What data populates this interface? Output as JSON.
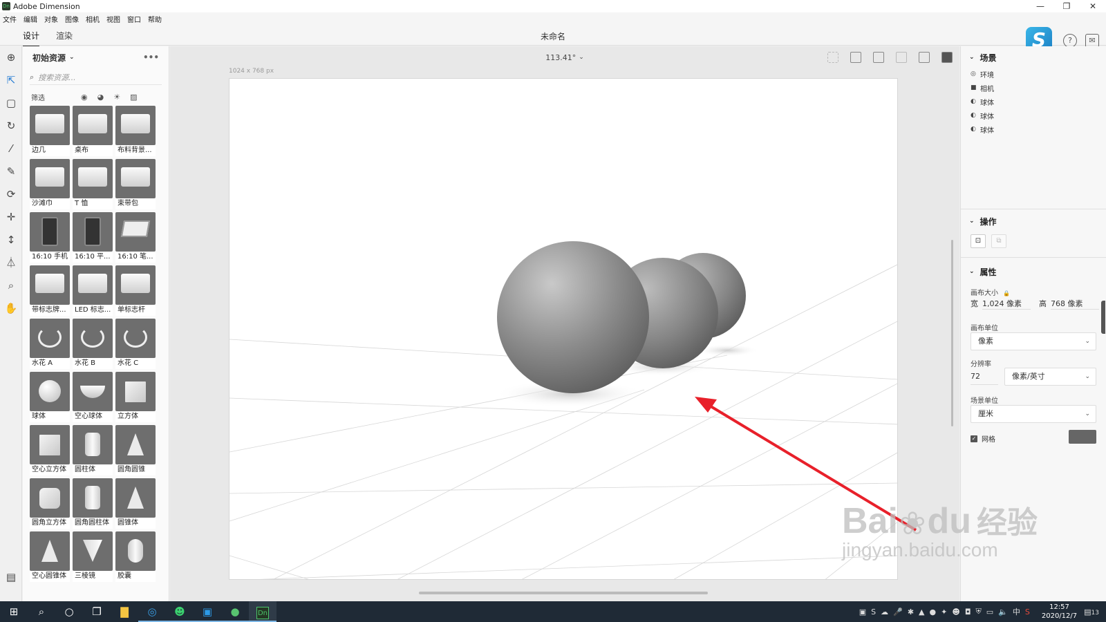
{
  "app": {
    "title": "Adobe Dimension",
    "logo": "Dn"
  },
  "window_controls": {
    "minimize": "—",
    "restore": "❐",
    "close": "✕"
  },
  "menu": [
    "文件",
    "编辑",
    "对象",
    "图像",
    "相机",
    "视图",
    "窗口",
    "帮助"
  ],
  "tabs": {
    "design": "设计",
    "render": "渲染"
  },
  "document": {
    "title": "未命名"
  },
  "top_right": {
    "avatar_letter": "S",
    "help_glyph": "?",
    "chat_glyph": "✉"
  },
  "left_panel": {
    "title": "初始资源",
    "search_placeholder": "搜索资源...",
    "filter_label": "筛选",
    "assets": [
      {
        "label": "边几"
      },
      {
        "label": "桌布"
      },
      {
        "label": "布料背景..."
      },
      {
        "label": "沙滩巾"
      },
      {
        "label": "T 恤"
      },
      {
        "label": "束带包"
      },
      {
        "label": "16:10 手机"
      },
      {
        "label": "16:10 平..."
      },
      {
        "label": "16:10 笔..."
      },
      {
        "label": "带标志牌..."
      },
      {
        "label": "LED 标志..."
      },
      {
        "label": "单标志杆"
      },
      {
        "label": "水花 A"
      },
      {
        "label": "水花 B"
      },
      {
        "label": "水花 C"
      },
      {
        "label": "球体"
      },
      {
        "label": "空心球体"
      },
      {
        "label": "立方体"
      },
      {
        "label": "空心立方体"
      },
      {
        "label": "圆柱体"
      },
      {
        "label": "圆角圆锥"
      },
      {
        "label": "圆角立方体"
      },
      {
        "label": "圆角圆柱体"
      },
      {
        "label": "圆锥体"
      },
      {
        "label": "空心圆锥体"
      },
      {
        "label": "三棱镜"
      },
      {
        "label": "胶囊"
      }
    ]
  },
  "viewport": {
    "zoom": "113.41°",
    "canvas_size": "1024 x 768 px"
  },
  "right_panel": {
    "scene_title": "场景",
    "scene_items": [
      {
        "label": "环境",
        "icon": "environment-icon"
      },
      {
        "label": "相机",
        "icon": "camera-icon"
      },
      {
        "label": "球体",
        "icon": "sphere-icon"
      },
      {
        "label": "球体",
        "icon": "sphere-icon"
      },
      {
        "label": "球体",
        "icon": "sphere-icon"
      }
    ],
    "actions_title": "操作",
    "properties_title": "属性",
    "canvas_size_label": "画布大小",
    "width_label": "宽",
    "width_value": "1,024 像素",
    "height_label": "高",
    "height_value": "768 像素",
    "canvas_unit_label": "画布单位",
    "canvas_unit_value": "像素",
    "resolution_label": "分辨率",
    "resolution_value": "72",
    "resolution_unit": "像素/英寸",
    "scene_unit_label": "场景单位",
    "scene_unit_value": "厘米",
    "grid_label": "网格",
    "grid_checked": true,
    "grid_color": "#666666"
  },
  "taskbar": {
    "time": "12:57",
    "date": "2020/12/7",
    "ime": "中",
    "notification_count": "13",
    "dn_label": "Dn"
  },
  "watermark": {
    "line1": "Bai",
    "line2": "du",
    "cn": "经验",
    "url": "jingyan.baidu.com"
  },
  "colors": {
    "accent_arrow": "#e8202a",
    "taskbar": "#1f2a36",
    "sphere": "#8a8a8a"
  }
}
